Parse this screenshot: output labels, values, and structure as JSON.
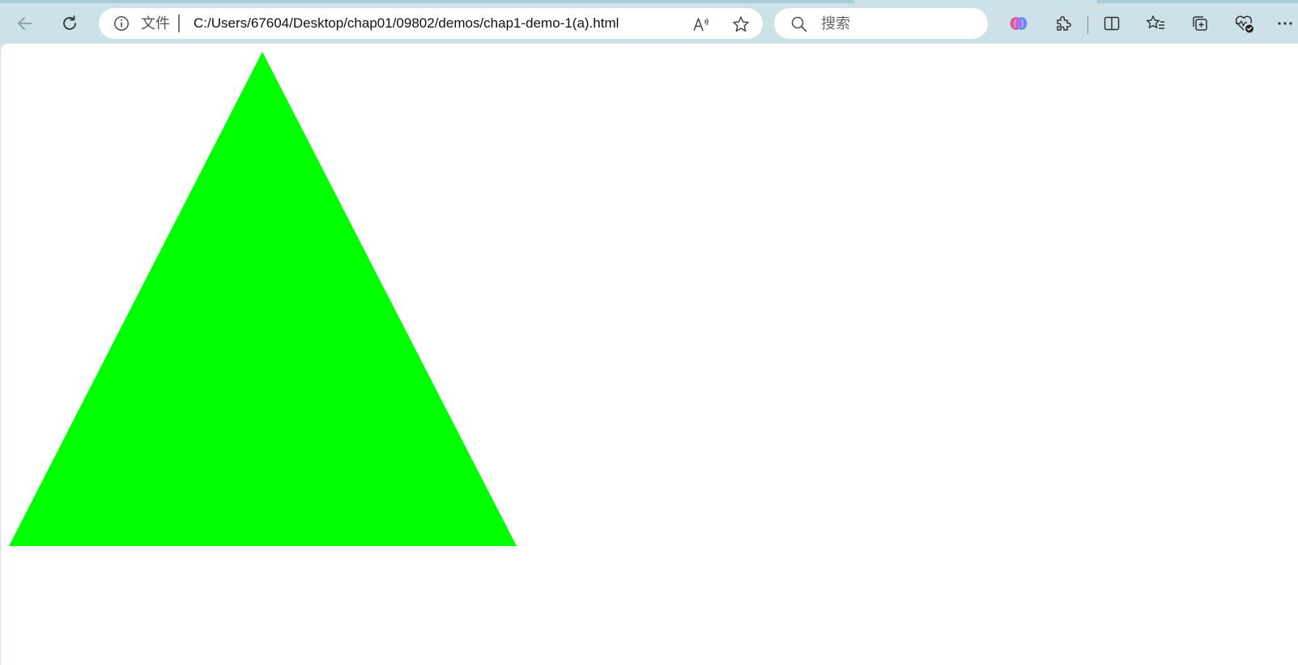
{
  "browser": {
    "address_bar": {
      "scheme_label": "文件",
      "url": "C:/Users/67604/Desktop/chap01/09802/demos/chap1-demo-1(a).html"
    },
    "search": {
      "placeholder": "搜索"
    },
    "icons": {
      "back": "back-arrow-icon",
      "refresh": "refresh-icon",
      "site_info": "info-icon",
      "read_aloud": "read-aloud-icon",
      "favorite": "star-icon",
      "search": "search-icon",
      "copilot": "copilot-icon",
      "extensions": "puzzle-icon",
      "split_screen": "split-screen-icon",
      "favorites_list": "favorites-list-icon",
      "collections": "collections-icon",
      "browser_essentials": "heartbeat-icon",
      "more": "more-icon"
    }
  },
  "page": {
    "background_color": "#ffffff",
    "shape": {
      "kind": "triangle",
      "fill_color": "#00ff00"
    }
  }
}
